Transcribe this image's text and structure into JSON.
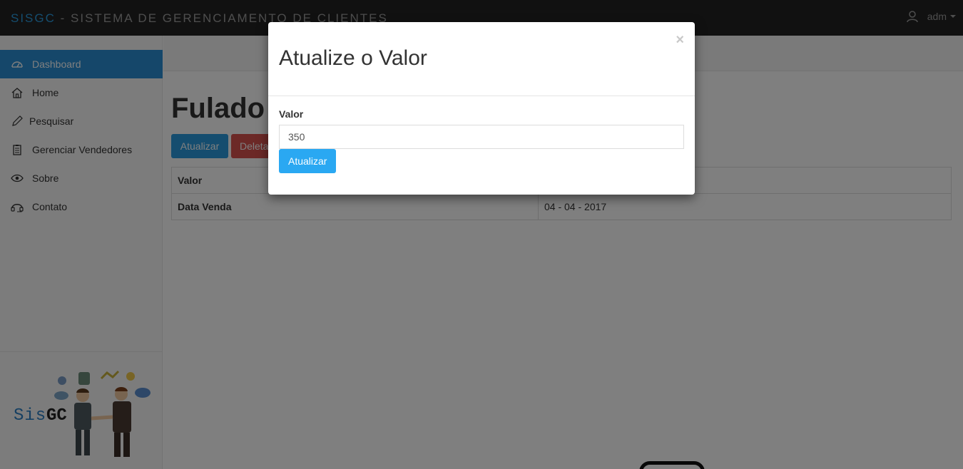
{
  "navbar": {
    "brand_accent": "SISGC",
    "brand_rest": " - SISTEMA DE GERENCIAMENTO DE CLIENTES",
    "user_label": "adm"
  },
  "sidebar": {
    "items": [
      {
        "label": "Dashboard",
        "icon": "dashboard-icon",
        "active": true
      },
      {
        "label": "Home",
        "icon": "home-icon"
      },
      {
        "label": "Pesquisar",
        "icon": "pencil-icon"
      },
      {
        "label": "Gerenciar Vendedores",
        "icon": "clipboard-icon"
      },
      {
        "label": "Sobre",
        "icon": "eye-icon"
      },
      {
        "label": "Contato",
        "icon": "headset-icon"
      }
    ],
    "logo_text": "SisGC"
  },
  "main": {
    "title": "Fulado d",
    "update_button": "Atualizar",
    "delete_button": "Deleta",
    "table": {
      "rows": [
        {
          "key": "Valor",
          "value": ""
        },
        {
          "key": "Data Venda",
          "value": "04 - 04 - 2017"
        }
      ]
    }
  },
  "modal": {
    "title": "Atualize o Valor",
    "close": "×",
    "field_label": "Valor",
    "field_value": "350",
    "submit_button": "Atualizar"
  },
  "colors": {
    "accent": "#2a9bde",
    "danger": "#d9534f",
    "navbar": "#222222"
  }
}
